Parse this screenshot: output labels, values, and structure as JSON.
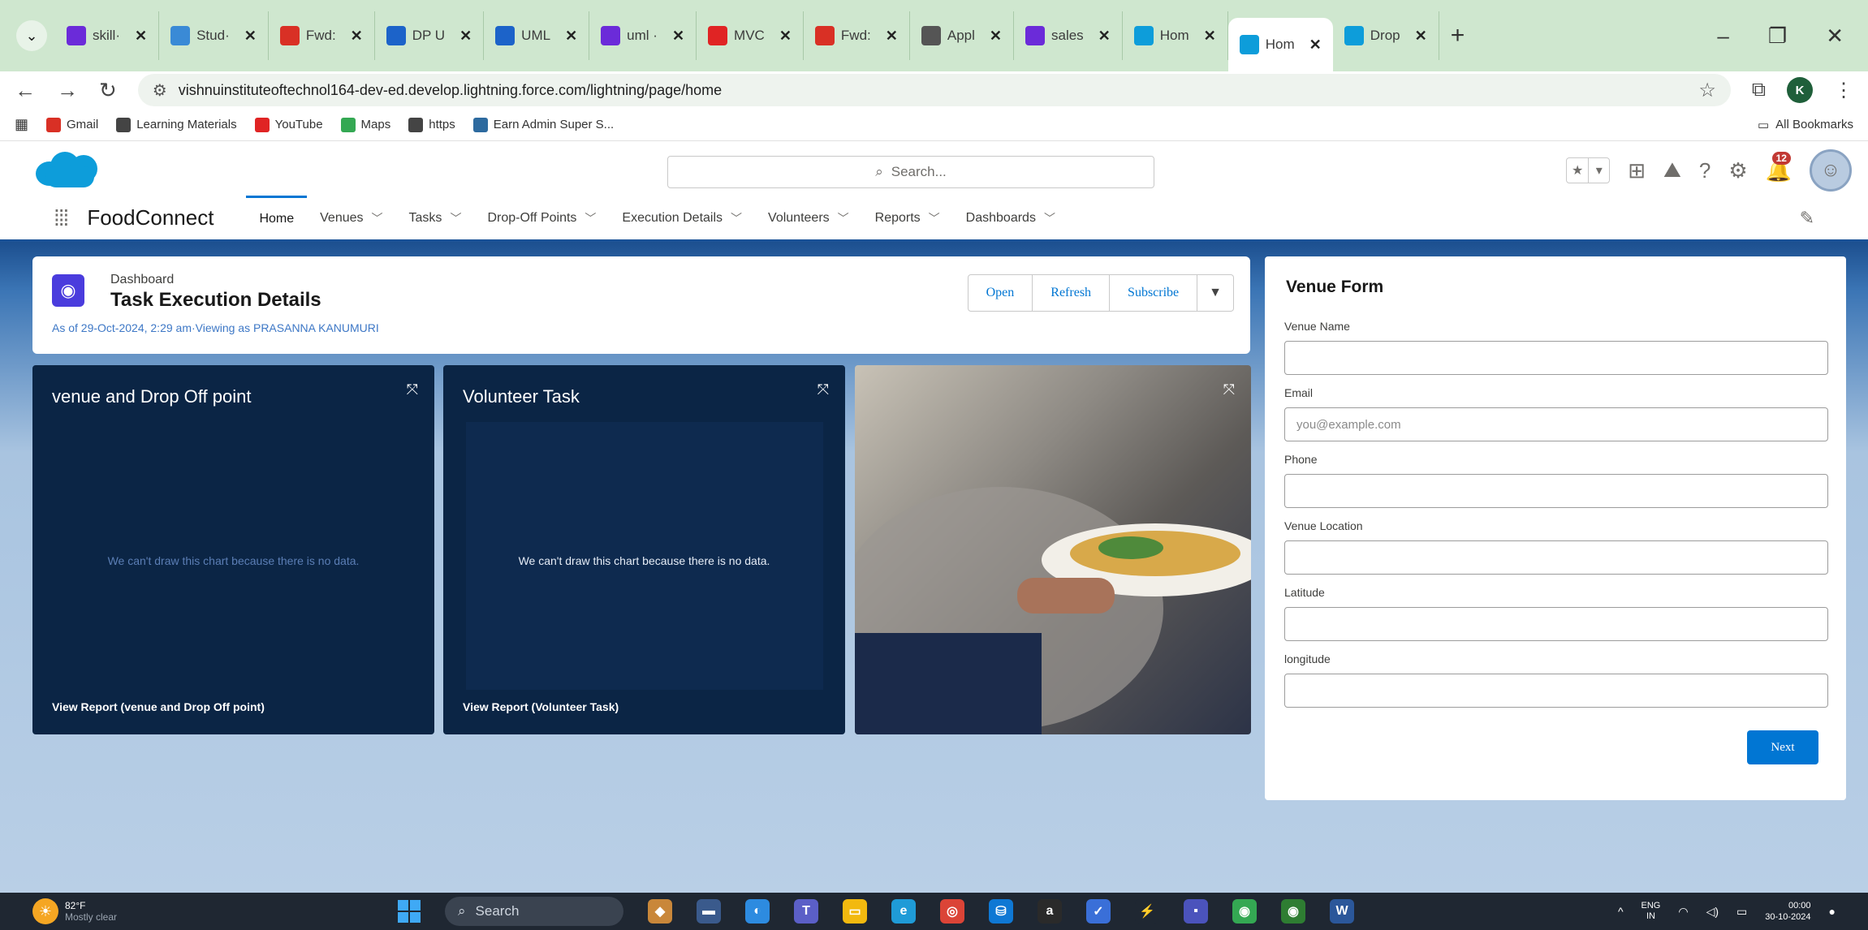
{
  "browser": {
    "tabs": [
      {
        "label": "skill·",
        "color": "#6b2bd9"
      },
      {
        "label": "Stud·",
        "color": "#3a8ad6"
      },
      {
        "label": "Fwd:",
        "color": "#d93025"
      },
      {
        "label": "DP U",
        "color": "#1c63c9"
      },
      {
        "label": "UML",
        "color": "#1c63c9"
      },
      {
        "label": "uml ·",
        "color": "#6b2bd9"
      },
      {
        "label": "MVC",
        "color": "#e02424"
      },
      {
        "label": "Fwd:",
        "color": "#d93025"
      },
      {
        "label": "Appl",
        "color": "#555555"
      },
      {
        "label": "sales",
        "color": "#6b2bd9"
      },
      {
        "label": "Hom",
        "color": "#0d9dda"
      },
      {
        "label": "Hom",
        "color": "#0d9dda",
        "active": true
      },
      {
        "label": "Drop",
        "color": "#0d9dda"
      }
    ],
    "url": "vishnuinstituteoftechnol164-dev-ed.develop.lightning.force.com/lightning/page/home",
    "profile_initial": "K",
    "bookmarks": [
      {
        "label": "Gmail",
        "color": "#d93025"
      },
      {
        "label": "Learning Materials",
        "color": "#444444"
      },
      {
        "label": "YouTube",
        "color": "#e02424"
      },
      {
        "label": "Maps",
        "color": "#34a853"
      },
      {
        "label": "https",
        "color": "#444444"
      },
      {
        "label": "Earn Admin Super S...",
        "color": "#2d6a9f"
      }
    ],
    "all_bookmarks": "All Bookmarks"
  },
  "sf": {
    "search_placeholder": "Search...",
    "notification_count": "12",
    "app_name": "FoodConnect",
    "nav": [
      {
        "label": "Home",
        "active": true,
        "menu": false
      },
      {
        "label": "Venues",
        "menu": true
      },
      {
        "label": "Tasks",
        "menu": true
      },
      {
        "label": "Drop-Off Points",
        "menu": true
      },
      {
        "label": "Execution Details",
        "menu": true
      },
      {
        "label": "Volunteers",
        "menu": true
      },
      {
        "label": "Reports",
        "menu": true
      },
      {
        "label": "Dashboards",
        "menu": true
      }
    ]
  },
  "dashboard": {
    "kicker": "Dashboard",
    "title": "Task Execution Details",
    "subtitle": "As of 29-Oct-2024, 2:29 am·Viewing as PRASANNA KANUMURI",
    "actions": {
      "open": "Open",
      "refresh": "Refresh",
      "subscribe": "Subscribe"
    },
    "widgets": [
      {
        "title": "venue and Drop Off point",
        "nodata": "We can't draw this chart because there is no data.",
        "footer": "View Report (venue and Drop Off point)"
      },
      {
        "title": "Volunteer Task",
        "nodata": "We can't draw this chart because there is no data.",
        "footer": "View Report (Volunteer Task)"
      }
    ]
  },
  "venue_form": {
    "title": "Venue Form",
    "fields": [
      {
        "label": "Venue Name",
        "placeholder": ""
      },
      {
        "label": "Email",
        "placeholder": "you@example.com"
      },
      {
        "label": "Phone",
        "placeholder": ""
      },
      {
        "label": "Venue Location",
        "placeholder": ""
      },
      {
        "label": "Latitude",
        "placeholder": ""
      },
      {
        "label": "longitude",
        "placeholder": ""
      }
    ],
    "next_label": "Next"
  },
  "taskbar": {
    "temperature": "82°F",
    "condition": "Mostly clear",
    "search_label": "Search",
    "lang_top": "ENG",
    "lang_bottom": "IN",
    "time": "00:00",
    "date": "30-10-2024"
  }
}
